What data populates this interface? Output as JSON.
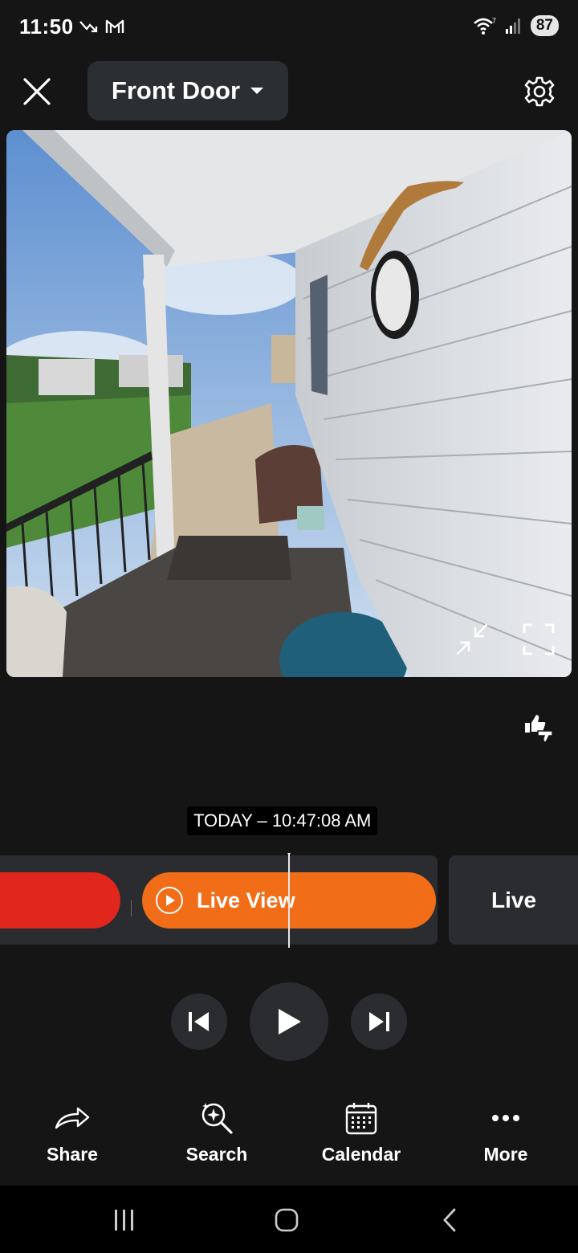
{
  "status_bar": {
    "time": "11:50",
    "battery": "87"
  },
  "header": {
    "device_name": "Front Door"
  },
  "timeline": {
    "timestamp": "TODAY – 10:47:08 AM",
    "live_view_label": "Live View",
    "live_label": "Live",
    "event_color": "#e0261d",
    "live_color": "#f26d17"
  },
  "actions": [
    {
      "label": "Share",
      "icon": "share-icon"
    },
    {
      "label": "Search",
      "icon": "search-sparkle-icon"
    },
    {
      "label": "Calendar",
      "icon": "calendar-icon"
    },
    {
      "label": "More",
      "icon": "more-icon"
    }
  ]
}
